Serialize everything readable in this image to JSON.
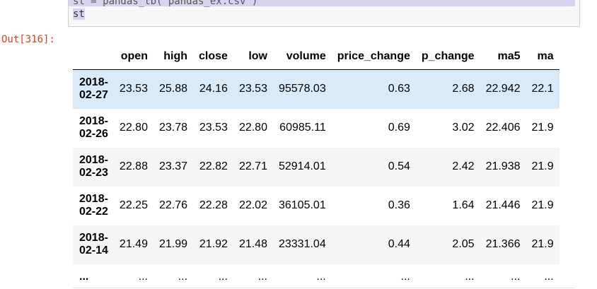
{
  "code": {
    "line_partial": "st = pandas_tb('pandas_ex.csv')",
    "line_var": "st"
  },
  "output": {
    "prompt": "Out[316]:"
  },
  "table": {
    "columns": [
      "open",
      "high",
      "close",
      "low",
      "volume",
      "price_change",
      "p_change",
      "ma5",
      "ma"
    ],
    "rows": [
      {
        "date_y": "2018-",
        "date_md": "02-27",
        "cells": [
          "23.53",
          "25.88",
          "24.16",
          "23.53",
          "95578.03",
          "0.63",
          "2.68",
          "22.942",
          "22.1"
        ]
      },
      {
        "date_y": "2018-",
        "date_md": "02-26",
        "cells": [
          "22.80",
          "23.78",
          "23.53",
          "22.80",
          "60985.11",
          "0.69",
          "3.02",
          "22.406",
          "21.9"
        ]
      },
      {
        "date_y": "2018-",
        "date_md": "02-23",
        "cells": [
          "22.88",
          "23.37",
          "22.82",
          "22.71",
          "52914.01",
          "0.54",
          "2.42",
          "21.938",
          "21.9"
        ]
      },
      {
        "date_y": "2018-",
        "date_md": "02-22",
        "cells": [
          "22.25",
          "22.76",
          "22.28",
          "22.02",
          "36105.01",
          "0.36",
          "1.64",
          "21.446",
          "21.9"
        ]
      },
      {
        "date_y": "2018-",
        "date_md": "02-14",
        "cells": [
          "21.49",
          "21.99",
          "21.92",
          "21.48",
          "23331.04",
          "0.44",
          "2.05",
          "21.366",
          "21.9"
        ]
      }
    ],
    "ellipsis_index": "...",
    "ellipsis_cells": [
      "...",
      "...",
      "...",
      "...",
      "...",
      "...",
      "...",
      "...",
      "..."
    ]
  }
}
